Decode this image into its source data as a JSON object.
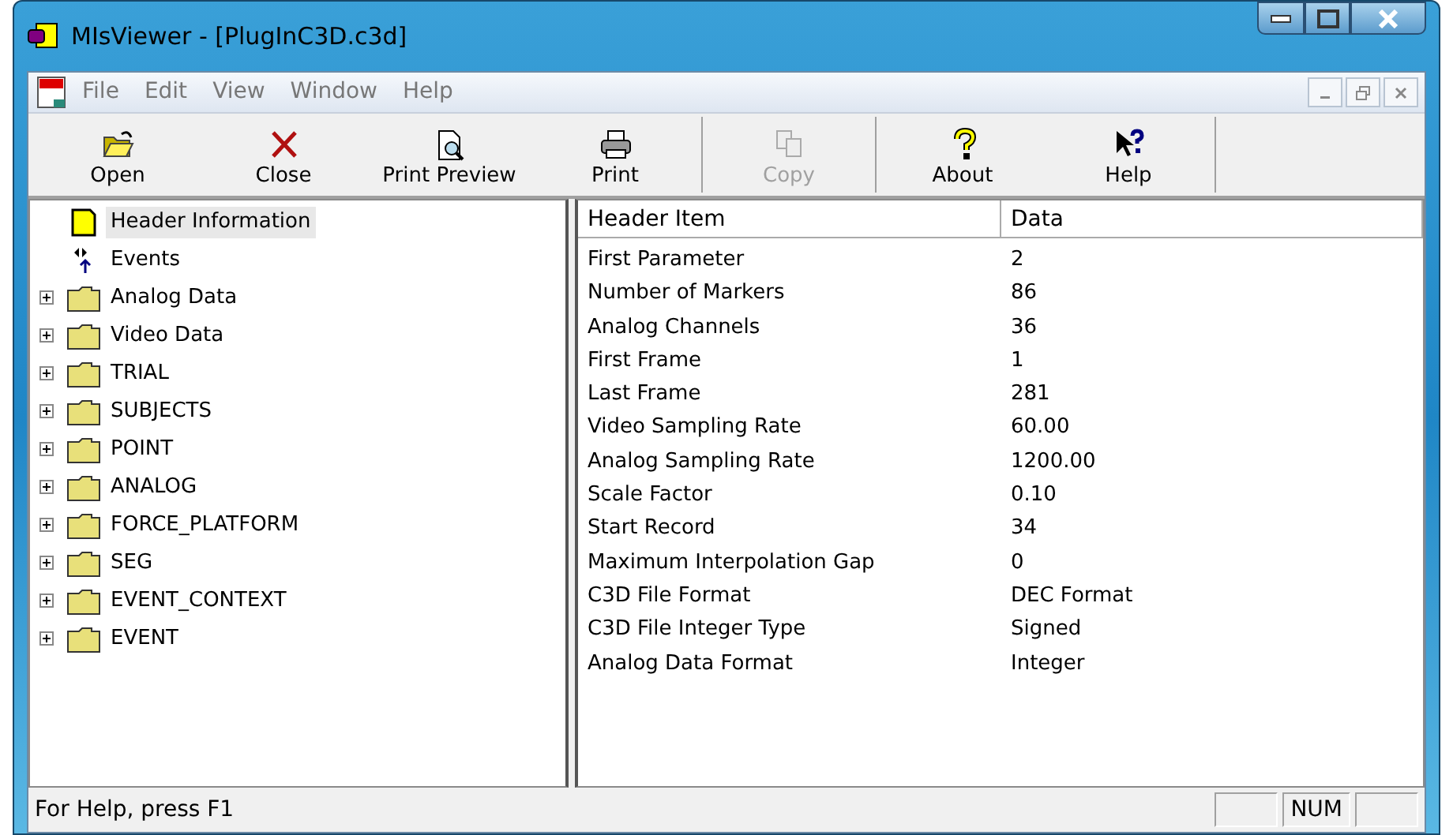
{
  "window": {
    "title": "MIsViewer - [PlugInC3D.c3d]"
  },
  "menu": [
    "File",
    "Edit",
    "View",
    "Window",
    "Help"
  ],
  "toolbar": [
    {
      "label": "Open",
      "disabled": false,
      "separator_before": false
    },
    {
      "label": "Close",
      "disabled": false,
      "separator_before": false
    },
    {
      "label": "Print Preview",
      "disabled": false,
      "separator_before": false
    },
    {
      "label": "Print",
      "disabled": false,
      "separator_before": false
    },
    {
      "label": "Copy",
      "disabled": true,
      "separator_before": true
    },
    {
      "label": "About",
      "disabled": false,
      "separator_before": true
    },
    {
      "label": "Help",
      "disabled": false,
      "separator_before": false
    }
  ],
  "tree": [
    {
      "label": "Header Information",
      "kind": "document",
      "selected": true
    },
    {
      "label": "Events",
      "kind": "events",
      "selected": false
    },
    {
      "label": "Analog Data",
      "kind": "folder",
      "selected": false,
      "expanded": false
    },
    {
      "label": "Video Data",
      "kind": "folder",
      "selected": false,
      "expanded": false
    },
    {
      "label": "TRIAL",
      "kind": "folder",
      "selected": false,
      "expanded": false
    },
    {
      "label": "SUBJECTS",
      "kind": "folder",
      "selected": false,
      "expanded": false
    },
    {
      "label": "POINT",
      "kind": "folder",
      "selected": false,
      "expanded": false
    },
    {
      "label": "ANALOG",
      "kind": "folder",
      "selected": false,
      "expanded": false
    },
    {
      "label": "FORCE_PLATFORM",
      "kind": "folder",
      "selected": false,
      "expanded": false
    },
    {
      "label": "SEG",
      "kind": "folder",
      "selected": false,
      "expanded": false
    },
    {
      "label": "EVENT_CONTEXT",
      "kind": "folder",
      "selected": false,
      "expanded": false
    },
    {
      "label": "EVENT",
      "kind": "folder",
      "selected": false,
      "expanded": false
    }
  ],
  "table": {
    "columns": [
      "Header Item",
      "Data"
    ],
    "rows": [
      [
        "First Parameter",
        "2"
      ],
      [
        "Number of Markers",
        "86"
      ],
      [
        "Analog Channels",
        "36"
      ],
      [
        "First Frame",
        "1"
      ],
      [
        "Last Frame",
        "281"
      ],
      [
        "Video Sampling Rate",
        "60.00"
      ],
      [
        "Analog Sampling Rate",
        "1200.00"
      ],
      [
        "Scale Factor",
        "0.10"
      ],
      [
        "Start Record",
        "34"
      ],
      [
        "Maximum Interpolation Gap",
        "0"
      ],
      [
        "C3D File Format",
        "DEC Format"
      ],
      [
        "C3D File Integer Type",
        "Signed"
      ],
      [
        "Analog Data Format",
        "Integer"
      ]
    ]
  },
  "status_bar": {
    "message": "For Help, press F1",
    "indicators": [
      "NUM"
    ]
  }
}
